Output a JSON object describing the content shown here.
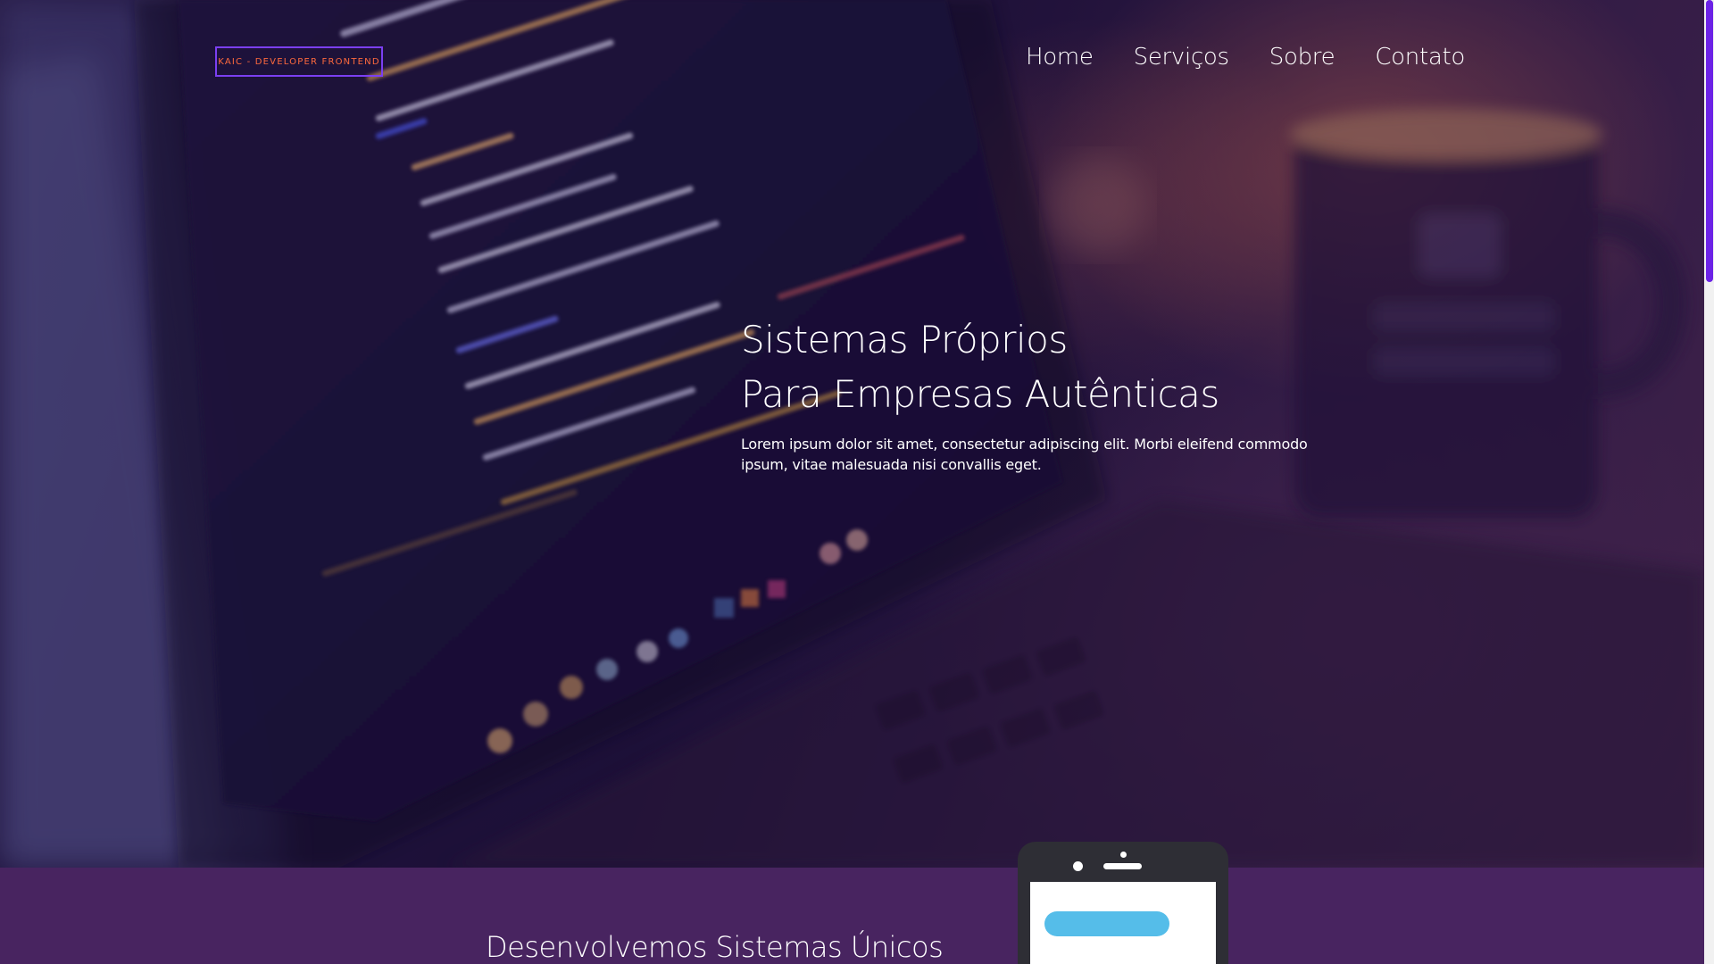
{
  "header": {
    "logo_text": "KAIC - DEVELOPER FRONTEND",
    "nav": [
      {
        "label": "Home"
      },
      {
        "label": "Serviços"
      },
      {
        "label": "Sobre"
      },
      {
        "label": "Contato"
      }
    ]
  },
  "hero": {
    "title_line1": "Sistemas Próprios",
    "title_line2": "Para Empresas Autênticas",
    "description": "Lorem ipsum dolor sit amet, consectetur adipiscing elit. Morbi eleifend commodo ipsum, vitae malesuada nisi convallis eget.",
    "background_image": "laptop-code-photo"
  },
  "section2": {
    "title": "Desenvolvemos Sistemas Únicos",
    "illustration": "smartphone-illustration"
  },
  "colors": {
    "accent_purple": "#7b3ff2",
    "logo_text": "#ff6a3d",
    "section_bg": "#482460",
    "phone_body": "#2e2e35",
    "phone_bar": "#55bde9",
    "scroll_thumb": "#6c22e6"
  }
}
